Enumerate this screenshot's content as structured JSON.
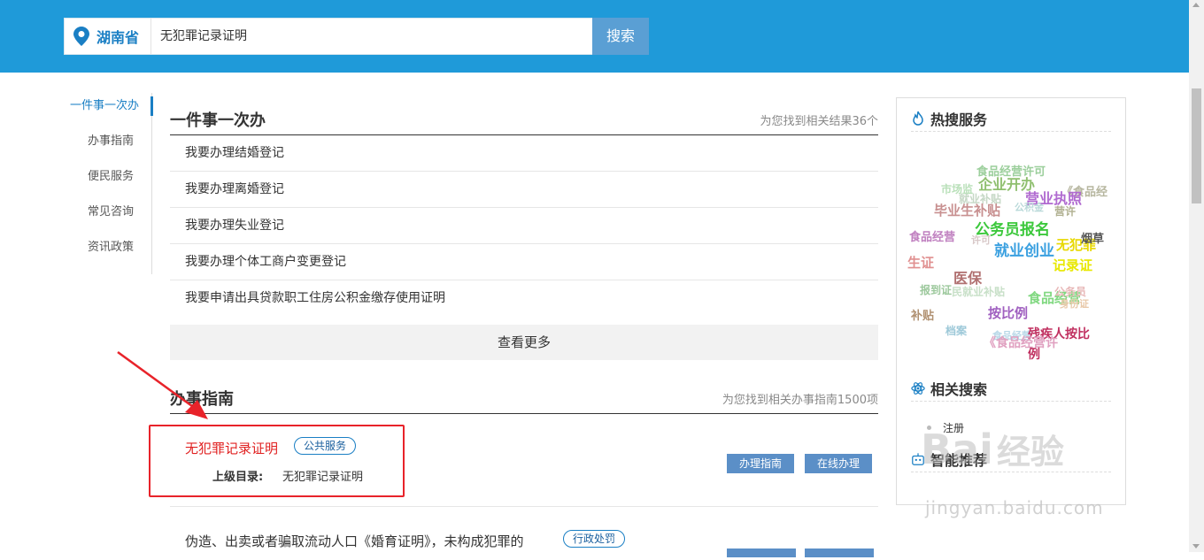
{
  "header": {
    "location": "湖南省",
    "query": "无犯罪记录证明",
    "search_label": "搜索"
  },
  "leftnav": {
    "items": [
      {
        "label": "一件事一次办",
        "active": true
      },
      {
        "label": "办事指南"
      },
      {
        "label": "便民服务"
      },
      {
        "label": "常见咨询"
      },
      {
        "label": "资讯政策"
      }
    ]
  },
  "section1": {
    "title": "一件事一次办",
    "count_text": "为您找到相关结果36个",
    "items": [
      "我要办理结婚登记",
      "我要办理离婚登记",
      "我要办理失业登记",
      "我要办理个体工商户变更登记",
      "我要申请出具贷款职工住房公积金缴存使用证明"
    ],
    "more_label": "查看更多"
  },
  "section2": {
    "title": "办事指南",
    "count_text": "为您找到相关办事指南1500项",
    "results": [
      {
        "title": "无犯罪记录证明",
        "tag": "公共服务",
        "parent_label": "上级目录:",
        "parent_value": "无犯罪记录证明",
        "btn_guide": "办理指南",
        "btn_online": "在线办理"
      },
      {
        "title": "伪造、出卖或者骗取流动人口《婚育证明》，未构成犯罪的",
        "tag": "行政处罚"
      }
    ]
  },
  "sidebar": {
    "hot_title": "热搜服务",
    "related_title": "相关搜索",
    "related_items": [
      "注册"
    ],
    "smart_title": "智能推荐",
    "cloud_words": [
      {
        "text": "食品经营许可",
        "color": "#9ccf9c"
      },
      {
        "text": "企业开办",
        "color": "#8fbf6f"
      },
      {
        "text": "《食品经",
        "color": "#b7b7a0"
      },
      {
        "text": "市场监",
        "color": "#b9e0b9"
      },
      {
        "text": "就业补贴",
        "color": "#c6d8c6"
      },
      {
        "text": "营业执照",
        "color": "#b06ad0"
      },
      {
        "text": "毕业生补贴",
        "color": "#c89090"
      },
      {
        "text": "公积金",
        "color": "#b9d9d9"
      },
      {
        "text": "营许",
        "color": "#b0b090"
      },
      {
        "text": "公务员报名",
        "color": "#3cc83c"
      },
      {
        "text": "食品经营",
        "color": "#c080c0"
      },
      {
        "text": "无犯罪",
        "color": "#e8d800"
      },
      {
        "text": "烟草",
        "color": "#555555"
      },
      {
        "text": "就业创业",
        "color": "#3aa0e0"
      },
      {
        "text": "许可",
        "color": "#d8c8c8"
      },
      {
        "text": "记录证",
        "color": "#e8e800"
      },
      {
        "text": "生证",
        "color": "#e09090"
      },
      {
        "text": "医保",
        "color": "#b07070"
      },
      {
        "text": "报到证",
        "color": "#9cc89c"
      },
      {
        "text": "民就业补贴",
        "color": "#c8e0c8"
      },
      {
        "text": "食品经营",
        "color": "#80d880"
      },
      {
        "text": "公务员",
        "color": "#e8b8b8"
      },
      {
        "text": "身份证",
        "color": "#e8c8a8"
      },
      {
        "text": "补贴",
        "color": "#b09070"
      },
      {
        "text": "按比例",
        "color": "#a060c0"
      },
      {
        "text": "档案",
        "color": "#9cc8d8"
      },
      {
        "text": "食品经营",
        "color": "#b8d8e8"
      },
      {
        "text": "残疾人按比",
        "color": "#c03060"
      },
      {
        "text": "《食品经营许",
        "color": "#e0a0c0"
      },
      {
        "text": "例",
        "color": "#c03060"
      }
    ]
  },
  "watermark": {
    "brand": "Bai",
    "brand2": "经验",
    "url": "jingyan.baidu.com"
  },
  "colors": {
    "header_bg": "#1f9ad9",
    "accent": "#1a7fc4",
    "highlight": "#e8232a",
    "button": "#5b8fc7"
  }
}
